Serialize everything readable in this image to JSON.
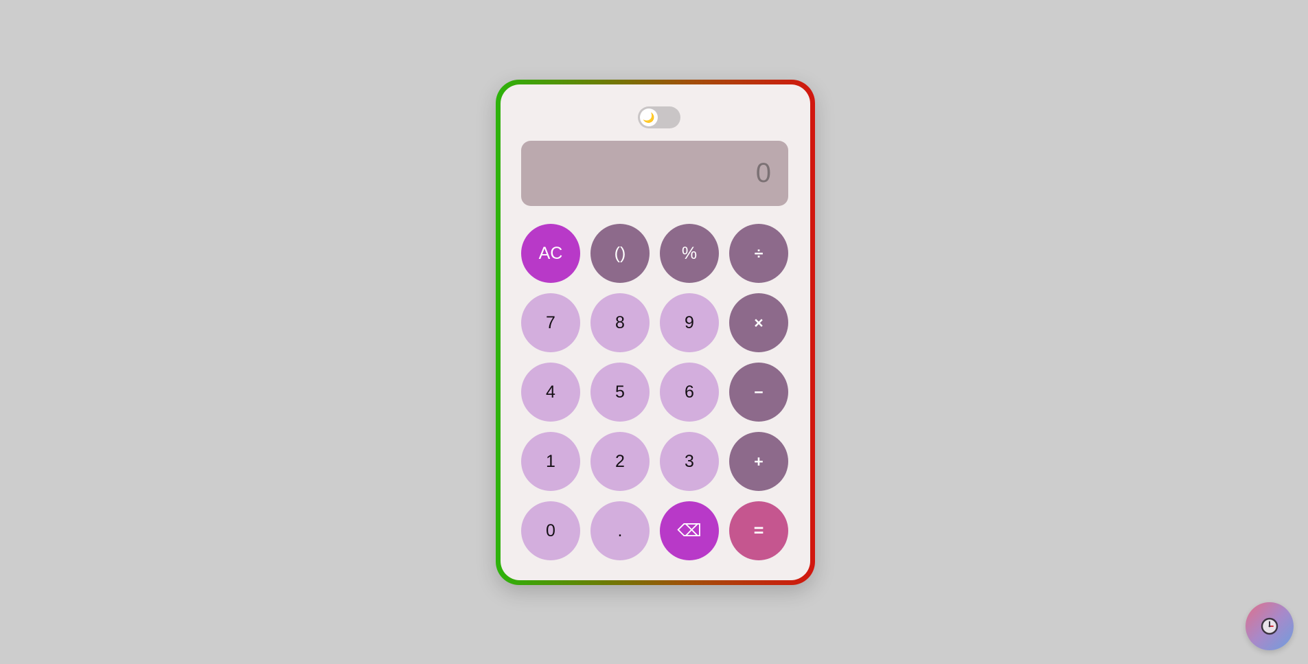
{
  "theme_toggle": {
    "icon": "moon-icon",
    "glyph": "🌙",
    "mode": "light"
  },
  "display": {
    "value": "0"
  },
  "keys": [
    {
      "label": "AC",
      "name": "clear-button",
      "kind": "func"
    },
    {
      "label": "()",
      "name": "parentheses-button",
      "kind": "fn-op"
    },
    {
      "label": "%",
      "name": "percent-button",
      "kind": "fn-op"
    },
    {
      "label": "÷",
      "name": "divide-button",
      "kind": "op"
    },
    {
      "label": "7",
      "name": "digit-7-button",
      "kind": "digit"
    },
    {
      "label": "8",
      "name": "digit-8-button",
      "kind": "digit"
    },
    {
      "label": "9",
      "name": "digit-9-button",
      "kind": "digit"
    },
    {
      "label": "×",
      "name": "multiply-button",
      "kind": "op"
    },
    {
      "label": "4",
      "name": "digit-4-button",
      "kind": "digit"
    },
    {
      "label": "5",
      "name": "digit-5-button",
      "kind": "digit"
    },
    {
      "label": "6",
      "name": "digit-6-button",
      "kind": "digit"
    },
    {
      "label": "−",
      "name": "subtract-button",
      "kind": "op"
    },
    {
      "label": "1",
      "name": "digit-1-button",
      "kind": "digit"
    },
    {
      "label": "2",
      "name": "digit-2-button",
      "kind": "digit"
    },
    {
      "label": "3",
      "name": "digit-3-button",
      "kind": "digit"
    },
    {
      "label": "+",
      "name": "add-button",
      "kind": "op"
    },
    {
      "label": "0",
      "name": "digit-0-button",
      "kind": "digit"
    },
    {
      "label": ".",
      "name": "decimal-button",
      "kind": "digit"
    },
    {
      "label": "⌫",
      "name": "backspace-button",
      "kind": "func"
    },
    {
      "label": "=",
      "name": "equals-button",
      "kind": "equals"
    }
  ],
  "history_button": {
    "icon": "clock-icon"
  },
  "colors": {
    "background": "#cdcdcd",
    "body": "#f3eeee",
    "display": "#bba9ae",
    "digit_key": "#d3aedd",
    "operator_key": "#8d6a8b",
    "function_key": "#b839c8",
    "equals_key": "#c5568f",
    "border_gradient_start": "#2cb30b",
    "border_gradient_end": "#d2160f"
  }
}
